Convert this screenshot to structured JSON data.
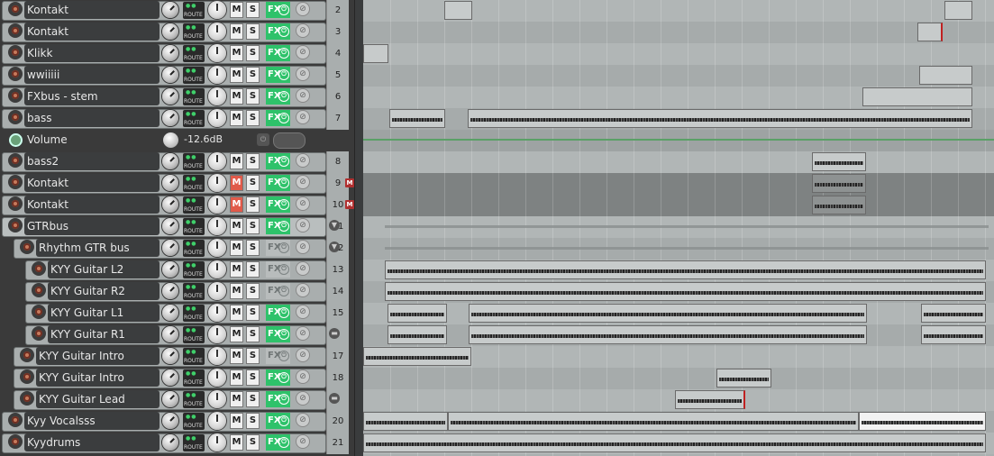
{
  "tracks": [
    {
      "name": "Kontakt",
      "number": "2",
      "fx_on": true,
      "muted": false
    },
    {
      "name": "Kontakt",
      "number": "3",
      "fx_on": true,
      "muted": false
    },
    {
      "name": "Klikk",
      "number": "4",
      "fx_on": true,
      "muted": false
    },
    {
      "name": "wwiiiii",
      "number": "5",
      "fx_on": true,
      "muted": false
    },
    {
      "name": "FXbus - stem",
      "number": "6",
      "fx_on": true,
      "muted": false
    },
    {
      "name": "bass",
      "number": "7",
      "fx_on": true,
      "muted": false
    },
    {
      "name": "bass2",
      "number": "8",
      "fx_on": true,
      "muted": false
    },
    {
      "name": "Kontakt",
      "number": "9",
      "fx_on": true,
      "muted": true
    },
    {
      "name": "Kontakt",
      "number": "10",
      "fx_on": true,
      "muted": true
    },
    {
      "name": "GTRbus",
      "number": "11",
      "fx_on": true,
      "muted": false
    },
    {
      "name": "Rhythm GTR bus",
      "number": "12",
      "fx_on": false,
      "muted": false
    },
    {
      "name": "KYY Guitar L2",
      "number": "13",
      "fx_on": false,
      "muted": false
    },
    {
      "name": "KYY Guitar R2",
      "number": "14",
      "fx_on": false,
      "muted": false
    },
    {
      "name": "KYY Guitar L1",
      "number": "15",
      "fx_on": true,
      "muted": false
    },
    {
      "name": "KYY Guitar R1",
      "number": "",
      "fx_on": true,
      "muted": false
    },
    {
      "name": "KYY Guitar Intro",
      "number": "17",
      "fx_on": false,
      "muted": false
    },
    {
      "name": "KYY Guitar Intro",
      "number": "18",
      "fx_on": true,
      "muted": false
    },
    {
      "name": "KYY Guitar Lead",
      "number": "",
      "fx_on": true,
      "muted": false
    },
    {
      "name": "Kyy Vocalsss",
      "number": "20",
      "fx_on": true,
      "muted": false
    },
    {
      "name": "Kyydrums",
      "number": "21",
      "fx_on": true,
      "muted": false
    }
  ],
  "envelope": {
    "name": "Volume",
    "value": "-12.6dB"
  },
  "labels": {
    "route": "ROUTE",
    "mute": "M",
    "solo": "S",
    "fx": "FX",
    "mute_badge": "M"
  },
  "colors": {
    "fx_active": "#2ec26a",
    "mute_active": "#e05a4a",
    "track_panel": "#a9aeae",
    "arrange_bg": "#aab0b0"
  }
}
